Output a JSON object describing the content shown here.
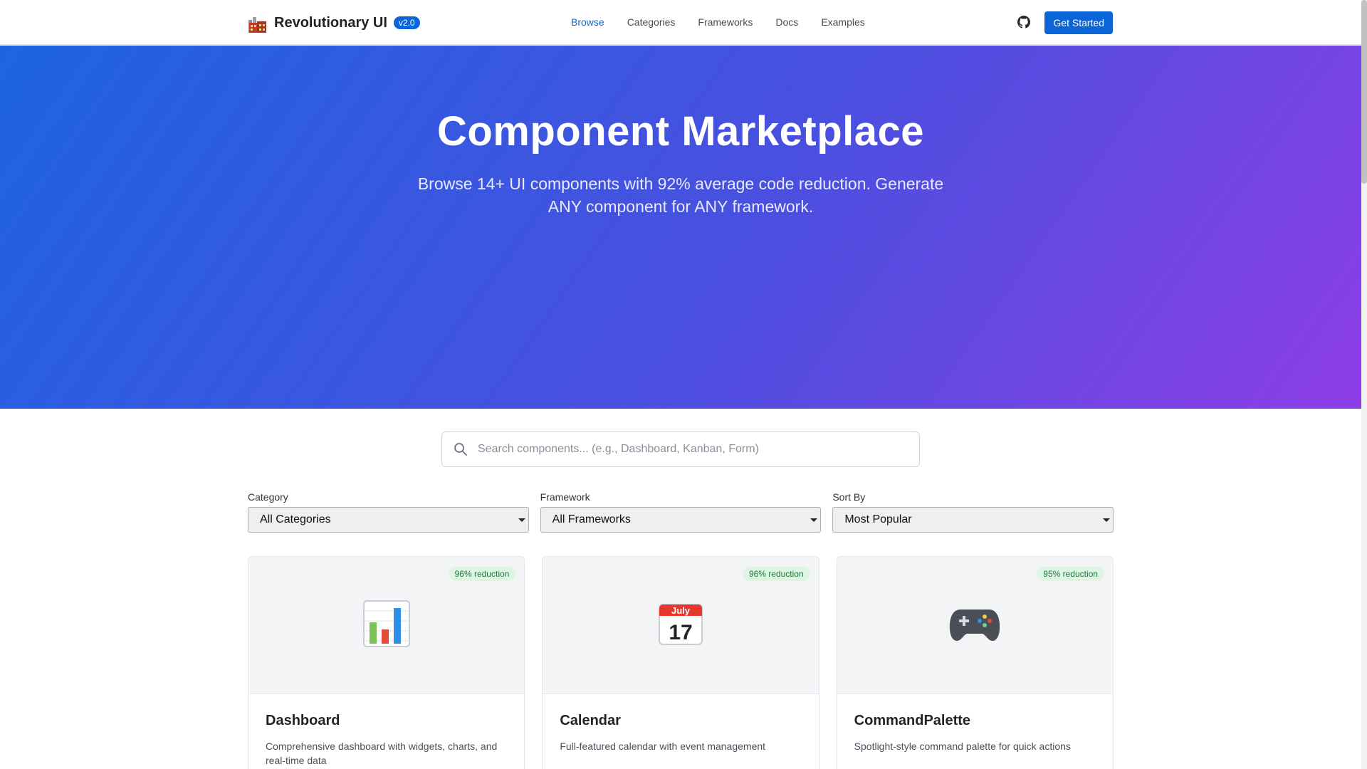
{
  "header": {
    "brand_name": "Revolutionary UI",
    "version": "v2.0",
    "nav": [
      {
        "label": "Browse",
        "active": true
      },
      {
        "label": "Categories",
        "active": false
      },
      {
        "label": "Frameworks",
        "active": false
      },
      {
        "label": "Docs",
        "active": false
      },
      {
        "label": "Examples",
        "active": false
      }
    ],
    "cta_label": "Get Started",
    "icons": {
      "brand": "factory-icon",
      "github": "github-icon"
    },
    "accent_color": "#0a66d8"
  },
  "hero": {
    "title": "Component Marketplace",
    "subtitle": "Browse 14+ UI components with 92% average code reduction. Generate ANY component for ANY framework.",
    "gradient": [
      "#1e64e0",
      "#4a4fdf",
      "#8e3ee6"
    ]
  },
  "search": {
    "placeholder": "Search components... (e.g., Dashboard, Kanban, Form)",
    "value": ""
  },
  "filters": [
    {
      "label": "Category",
      "selected": "All Categories"
    },
    {
      "label": "Framework",
      "selected": "All Frameworks"
    },
    {
      "label": "Sort By",
      "selected": "Most Popular"
    }
  ],
  "cards": [
    {
      "title": "Dashboard",
      "description": "Comprehensive dashboard with widgets, charts, and real-time data",
      "reduction": "96% reduction",
      "icon": "bar-chart-icon"
    },
    {
      "title": "Calendar",
      "description": "Full-featured calendar with event management",
      "reduction": "96% reduction",
      "icon": "calendar-icon",
      "icon_month": "July",
      "icon_day": "17"
    },
    {
      "title": "CommandPalette",
      "description": "Spotlight-style command palette for quick actions",
      "reduction": "95% reduction",
      "icon": "game-controller-icon"
    }
  ]
}
